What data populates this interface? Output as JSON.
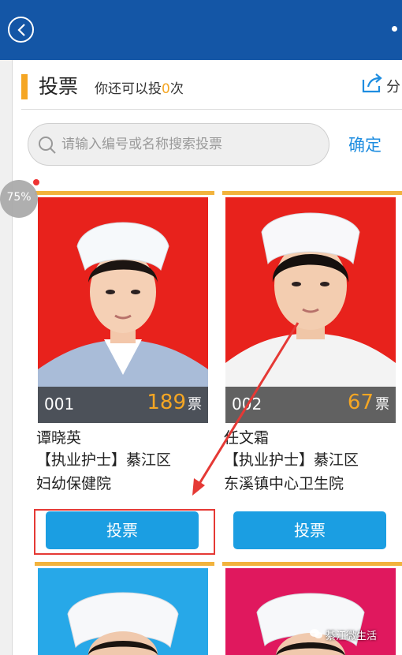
{
  "header": {
    "back_icon": "back-arrow-icon",
    "more_icon": "dot-icon"
  },
  "vote_section": {
    "title": "投票",
    "subtitle_prefix": "你还可以投",
    "remaining": "0",
    "subtitle_suffix": "次",
    "share_label": "分",
    "share_icon": "share-icon"
  },
  "search": {
    "placeholder": "请输入编号或名称搜索投票",
    "confirm_label": "确定",
    "icon": "search-icon"
  },
  "progress_badge": {
    "label": "75%"
  },
  "colors": {
    "header": "#1456a6",
    "accent": "#f5a623",
    "button": "#1b9ee2",
    "highlight": "#e53935"
  },
  "candidates": [
    {
      "id": "001",
      "votes": "189",
      "votes_unit": "票",
      "name": "谭晓英",
      "desc_line1": "【执业护士】綦江区",
      "desc_line2": "妇幼保健院",
      "button": "投票",
      "photo_bg": "#e8221c"
    },
    {
      "id": "002",
      "votes": "67",
      "votes_unit": "票",
      "name": "任文霜",
      "desc_line1": "【执业护士】綦江区",
      "desc_line2": "东溪镇中心卫生院",
      "button": "投票",
      "photo_bg": "#e8221c"
    },
    {
      "photo_bg": "#27a8e8"
    },
    {
      "photo_bg": "#e0185e"
    }
  ],
  "watermark": {
    "text": "綦江微生活"
  }
}
